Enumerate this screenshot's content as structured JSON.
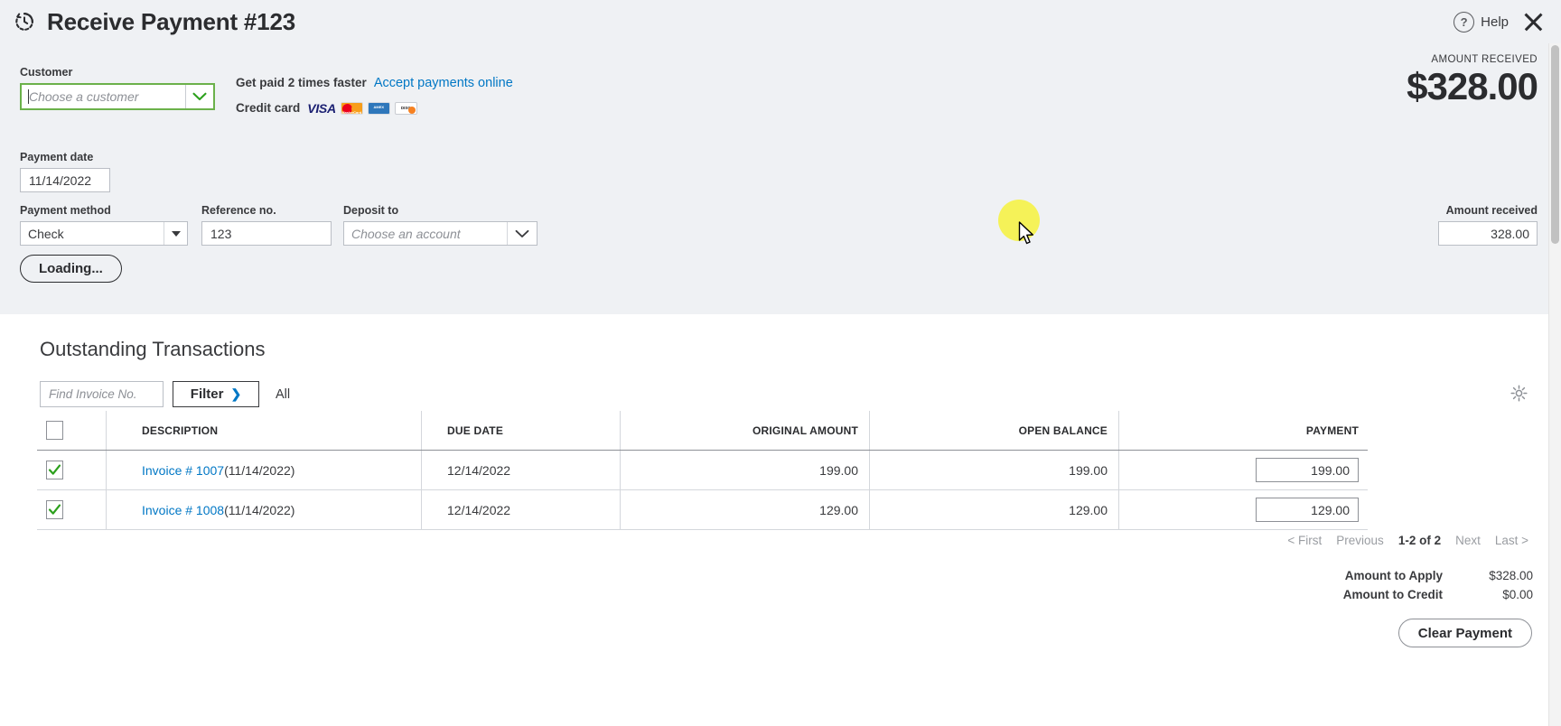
{
  "header": {
    "title": "Receive Payment #123",
    "icon": "clock-history-icon",
    "help_label": "Help",
    "help_icon": "question-circle-icon",
    "close_icon": "close-icon"
  },
  "form": {
    "customer": {
      "label": "Customer",
      "value": "",
      "placeholder": "Choose a customer",
      "focus_color": "#6bb14a"
    },
    "promo": {
      "text": "Get paid 2 times faster",
      "link": "Accept payments online",
      "link_color": "#0077c5",
      "credit_card_label": "Credit card",
      "cards": [
        "VISA",
        "MasterCard",
        "American Express",
        "Discover"
      ]
    },
    "amount_received_display": {
      "label": "AMOUNT RECEIVED",
      "value": "$328.00"
    },
    "payment_date": {
      "label": "Payment date",
      "value": "11/14/2022"
    },
    "payment_method": {
      "label": "Payment method",
      "value": "Check"
    },
    "reference_no": {
      "label": "Reference no.",
      "value": "123"
    },
    "deposit_to": {
      "label": "Deposit to",
      "value": "",
      "placeholder": "Choose an account"
    },
    "amount_received_field": {
      "label": "Amount received",
      "value": "328.00"
    },
    "loading_button": "Loading..."
  },
  "transactions": {
    "title": "Outstanding Transactions",
    "find_placeholder": "Find Invoice No.",
    "find_value": "",
    "filter_label": "Filter",
    "filter_chevron": "❯",
    "all_label": "All",
    "gear_icon": "gear-icon",
    "columns": [
      "",
      "DESCRIPTION",
      "DUE DATE",
      "ORIGINAL AMOUNT",
      "OPEN BALANCE",
      "PAYMENT"
    ],
    "header_checkbox_checked": false,
    "rows": [
      {
        "checked": true,
        "description_link": "Invoice # 1007",
        "description_date": " (11/14/2022)",
        "due_date": "12/14/2022",
        "original_amount": "199.00",
        "open_balance": "199.00",
        "payment": "199.00"
      },
      {
        "checked": true,
        "description_link": "Invoice # 1008",
        "description_date": " (11/14/2022)",
        "due_date": "12/14/2022",
        "original_amount": "129.00",
        "open_balance": "129.00",
        "payment": "129.00"
      }
    ],
    "pager": {
      "first": "< First",
      "previous": "Previous",
      "range": "1-2 of 2",
      "next": "Next",
      "last": "Last >"
    },
    "totals": [
      {
        "label": "Amount to Apply",
        "value": "$328.00"
      },
      {
        "label": "Amount to Credit",
        "value": "$0.00"
      }
    ],
    "clear_button": "Clear Payment"
  }
}
